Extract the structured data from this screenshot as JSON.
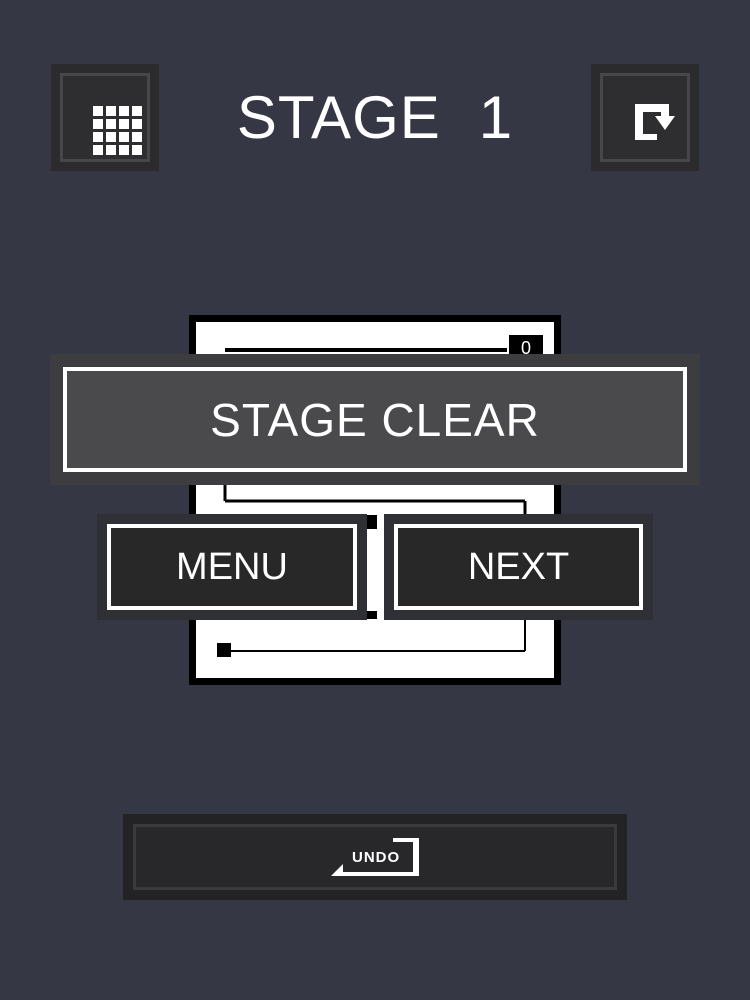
{
  "header": {
    "stage_word": "STAGE",
    "stage_number": "1",
    "menu_icon": "grid-icon",
    "reset_icon": "restart-arrow-icon"
  },
  "board": {
    "corner_counter": "0"
  },
  "dialog": {
    "title": "STAGE CLEAR",
    "menu_label": "MENU",
    "next_label": "NEXT"
  },
  "footer": {
    "undo_label": "UNDO",
    "undo_icon": "undo-arrow-icon"
  },
  "colors": {
    "background": "#353844",
    "button_dark": "#282829",
    "banner": "#4a4a4c",
    "text": "#ffffff"
  }
}
